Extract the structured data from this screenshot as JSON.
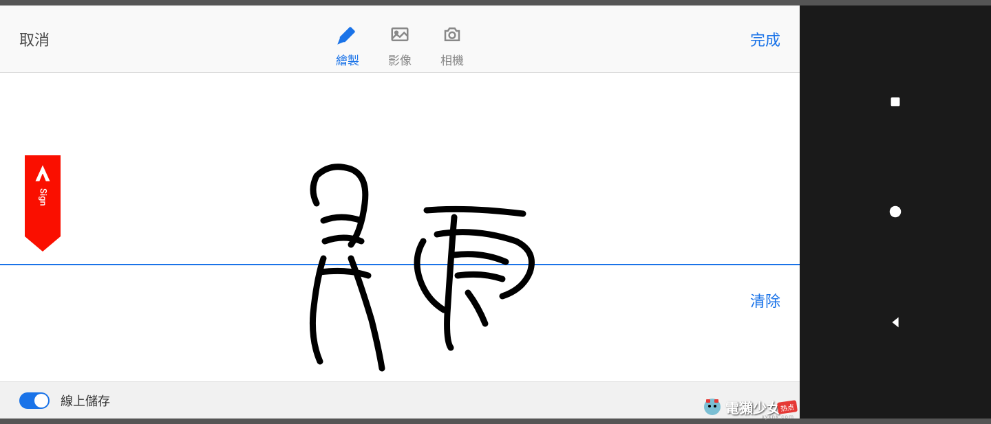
{
  "header": {
    "cancel_label": "取消",
    "done_label": "完成",
    "tabs": [
      {
        "id": "draw",
        "label": "繪製",
        "active": true
      },
      {
        "id": "image",
        "label": "影像",
        "active": false
      },
      {
        "id": "camera",
        "label": "相機",
        "active": false
      }
    ]
  },
  "badge": {
    "brand": "Adobe",
    "product": "Sign"
  },
  "canvas": {
    "clear_label": "清除"
  },
  "footer": {
    "save_online_label": "線上儲存",
    "toggle_on": true
  },
  "watermark": {
    "text": "電獺少女",
    "badge_text": "热点",
    "sub_text": "xyxnk.com"
  },
  "colors": {
    "accent": "#1a73e8",
    "adobe_red": "#fa0f00"
  }
}
